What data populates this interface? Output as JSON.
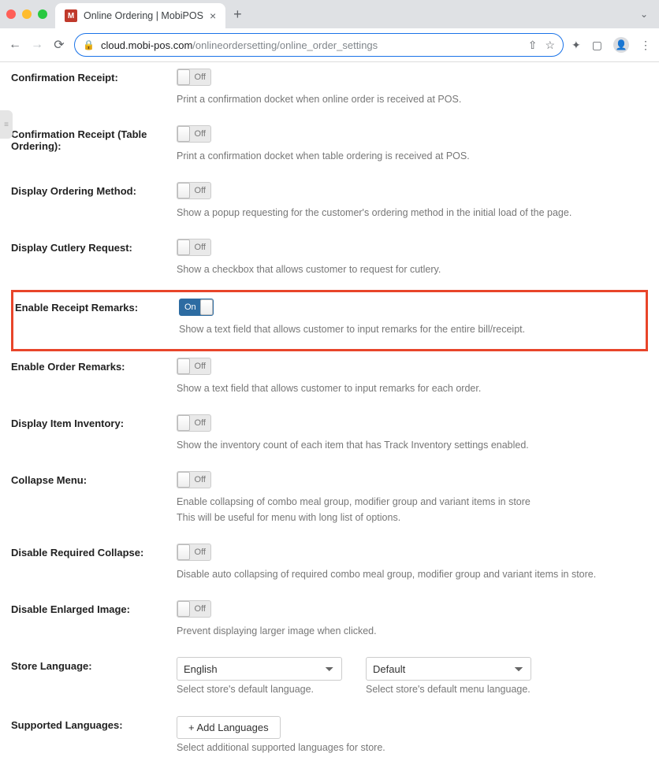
{
  "browser": {
    "tab_title": "Online Ordering | MobiPOS",
    "url_host": "cloud.mobi-pos.com",
    "url_path": "/onlineordersetting/online_order_settings"
  },
  "toggle_labels": {
    "on": "On",
    "off": "Off"
  },
  "rows": {
    "confirmation_receipt": {
      "label": "Confirmation Receipt:",
      "help": "Print a confirmation docket when online order is received at POS."
    },
    "confirmation_receipt_table": {
      "label": "Confirmation Receipt (Table Ordering):",
      "help": "Print a confirmation docket when table ordering is received at POS."
    },
    "display_ordering_method": {
      "label": "Display Ordering Method:",
      "help": "Show a popup requesting for the customer's ordering method in the initial load of the page."
    },
    "display_cutlery_request": {
      "label": "Display Cutlery Request:",
      "help": "Show a checkbox that allows customer to request for cutlery."
    },
    "enable_receipt_remarks": {
      "label": "Enable Receipt Remarks:",
      "help": "Show a text field that allows customer to input remarks for the entire bill/receipt."
    },
    "enable_order_remarks": {
      "label": "Enable Order Remarks:",
      "help": "Show a text field that allows customer to input remarks for each order."
    },
    "display_item_inventory": {
      "label": "Display Item Inventory:",
      "help": "Show the inventory count of each item that has Track Inventory settings enabled."
    },
    "collapse_menu": {
      "label": "Collapse Menu:",
      "help1": "Enable collapsing of combo meal group, modifier group and variant items in store",
      "help2": "This will be useful for menu with long list of options."
    },
    "disable_required_collapse": {
      "label": "Disable Required Collapse:",
      "help": "Disable auto collapsing of required combo meal group, modifier group and variant items in store."
    },
    "disable_enlarged_image": {
      "label": "Disable Enlarged Image:",
      "help": "Prevent displaying larger image when clicked."
    },
    "store_language": {
      "label": "Store Language:",
      "select1_value": "English",
      "select2_value": "Default",
      "help1": "Select store's default language.",
      "help2": "Select store's default menu language."
    },
    "supported_languages": {
      "label": "Supported Languages:",
      "button": "+ Add Languages",
      "help": "Select additional supported languages for store."
    }
  }
}
